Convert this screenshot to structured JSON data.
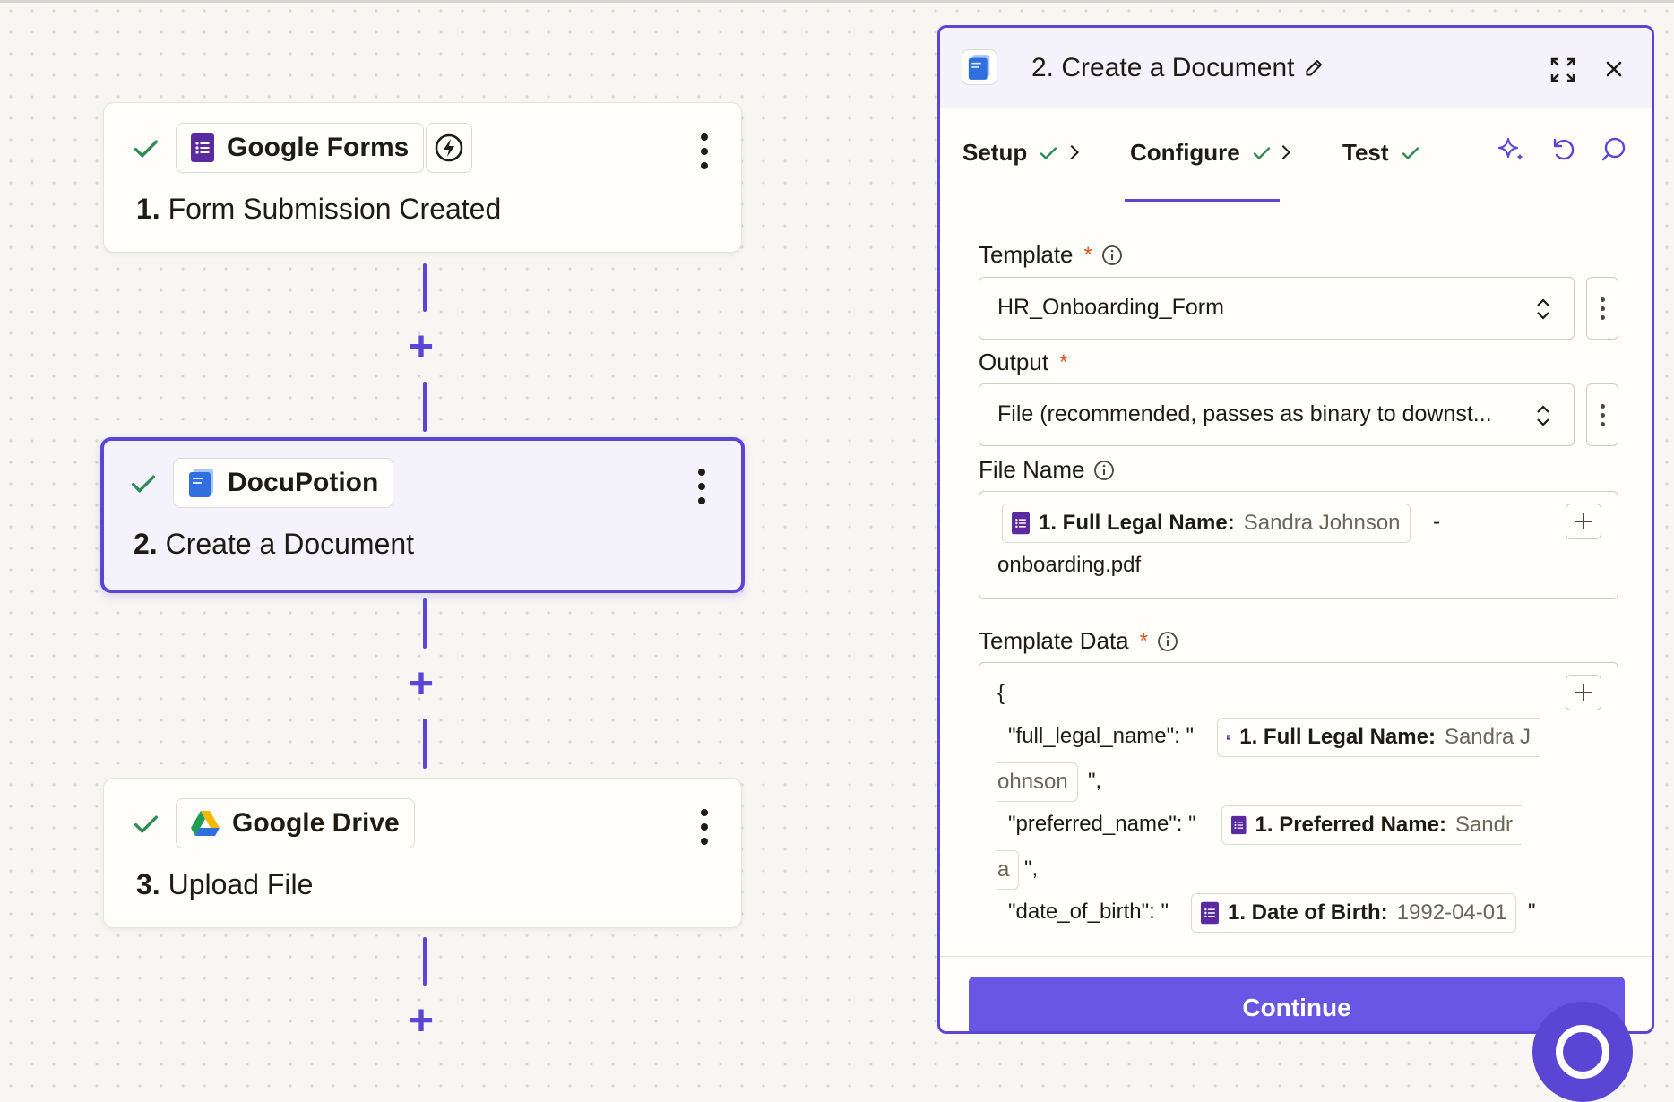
{
  "colors": {
    "accent": "#5a45d4",
    "button": "#6a56e4",
    "check": "#2e8b57",
    "required": "#e2531a",
    "forms_purple": "#5b2aa0",
    "docs_blue": "#2f6fe0"
  },
  "canvas": {
    "steps": [
      {
        "app": "Google Forms",
        "number": "1.",
        "title": "Form Submission Created",
        "app_icon": "google-forms-icon",
        "status_icon": "check-icon",
        "trigger_icon": "lightning-icon",
        "active": false
      },
      {
        "app": "DocuPotion",
        "number": "2.",
        "title": "Create a Document",
        "app_icon": "docupotion-icon",
        "status_icon": "check-icon",
        "active": true
      },
      {
        "app": "Google Drive",
        "number": "3.",
        "title": "Upload File",
        "app_icon": "google-drive-icon",
        "status_icon": "check-icon",
        "active": false
      }
    ],
    "add_step_symbol": "+"
  },
  "panel": {
    "title": "2. Create a Document",
    "tabs": [
      {
        "label": "Setup",
        "done": true
      },
      {
        "label": "Configure",
        "done": true,
        "selected": true
      },
      {
        "label": "Test",
        "done": true
      }
    ],
    "fields": {
      "template": {
        "label": "Template",
        "required": "*",
        "value": "HR_Onboarding_Form"
      },
      "output": {
        "label": "Output",
        "required": "*",
        "value": "File (recommended, passes as binary to downst..."
      },
      "file_name": {
        "label": "File Name",
        "pill_label": "1. Full Legal Name:",
        "pill_value": "Sandra Johnson",
        "separator": "-",
        "suffix": "onboarding.pdf"
      },
      "template_data": {
        "label": "Template Data",
        "required": "*",
        "open_brace": "{",
        "lines": [
          {
            "key": "\"full_legal_name\": \"",
            "pill_label": "1. Full Legal Name:",
            "pill_value_part1": "Sandra J",
            "pill_value_part2": "ohnson",
            "tail": "\","
          },
          {
            "key": "\"preferred_name\": \"",
            "pill_label": "1. Preferred Name:",
            "pill_value_part1": "Sandr",
            "pill_value_part2": "a",
            "tail": "\","
          },
          {
            "key": "\"date_of_birth\": \"",
            "pill_label": "1. Date of Birth:",
            "pill_value_part1": "1992-04-01",
            "tail": "\""
          }
        ]
      }
    },
    "continue_label": "Continue"
  }
}
